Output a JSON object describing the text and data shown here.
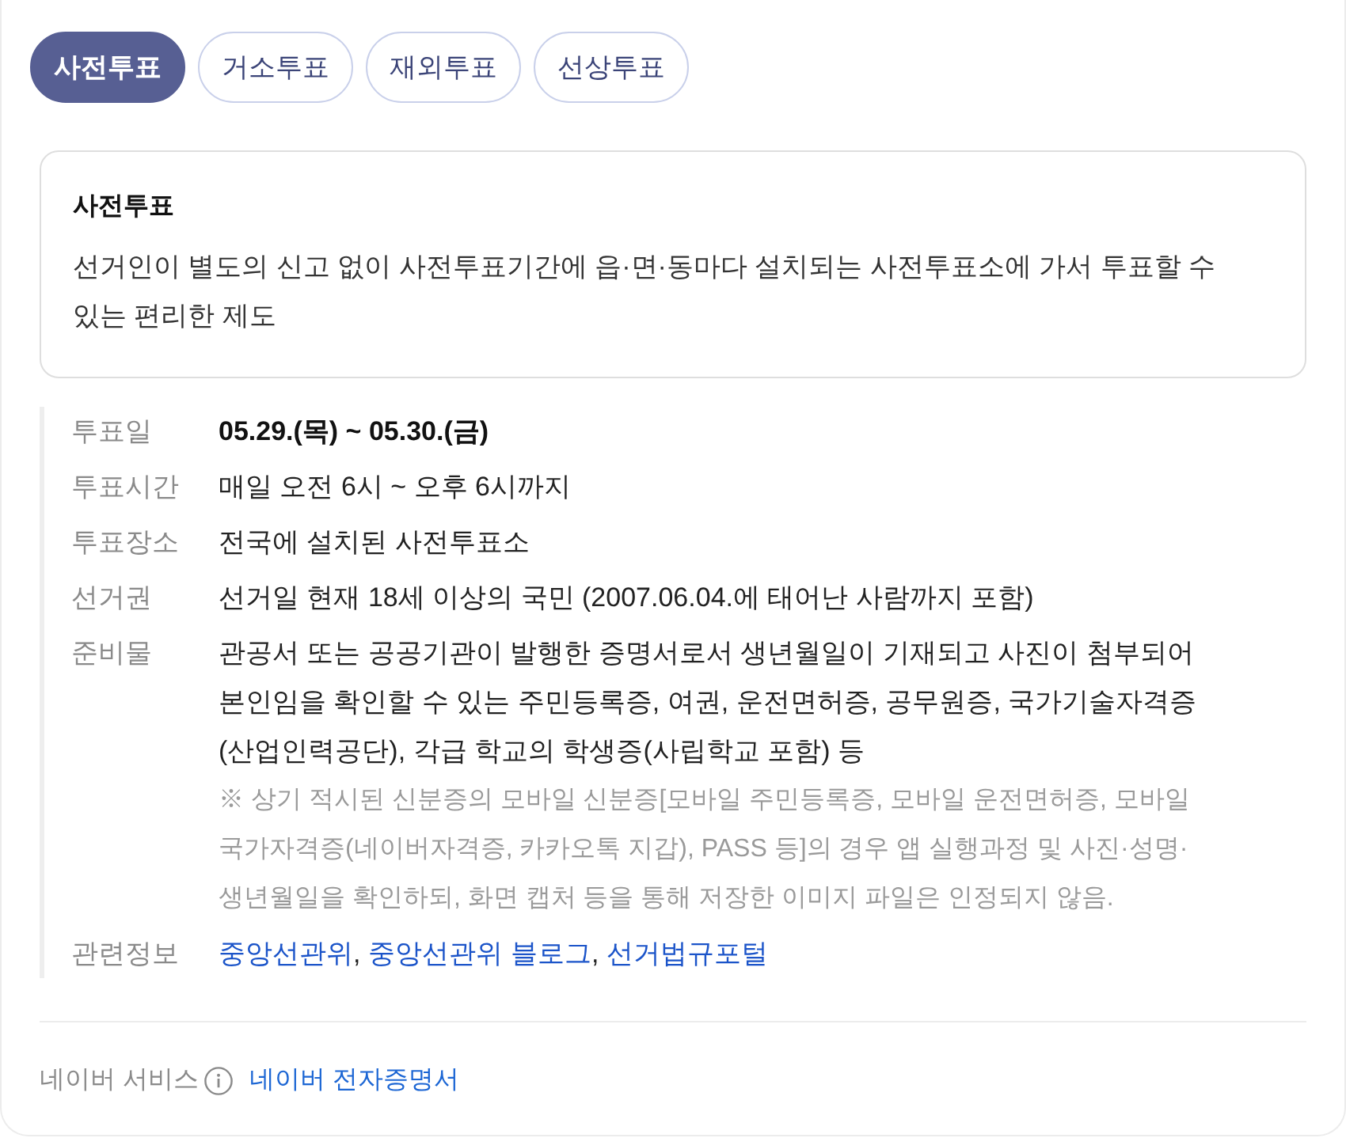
{
  "tabs": [
    {
      "label": "사전투표",
      "selected": true
    },
    {
      "label": "거소투표",
      "selected": false
    },
    {
      "label": "재외투표",
      "selected": false
    },
    {
      "label": "선상투표",
      "selected": false
    }
  ],
  "definition": {
    "title": "사전투표",
    "text": "선거인이 별도의 신고 없이 사전투표기간에 읍·면·동마다 설치되는 사전투표소에 가서 투표할 수 있는 편리한 제도"
  },
  "details": [
    {
      "kind": "text",
      "label": "투표일",
      "value": "05.29.(목) ~ 05.30.(금)",
      "bold": true
    },
    {
      "kind": "text",
      "label": "투표시간",
      "value": "매일 오전 6시 ~ 오후 6시까지",
      "bold": false
    },
    {
      "kind": "text",
      "label": "투표장소",
      "value": "전국에 설치된 사전투표소",
      "bold": false
    },
    {
      "kind": "text",
      "label": "선거권",
      "value": "선거일 현재 18세 이상의 국민 (2007.06.04.에 태어난 사람까지 포함)",
      "bold": false
    },
    {
      "kind": "text",
      "label": "준비물",
      "value": "관공서 또는 공공기관이 발행한 증명서로서 생년월일이 기재되고 사진이 첨부되어 본인임을 확인할 수 있는 주민등록증, 여권, 운전면허증, 공무원증, 국가기술자격증(산업인력공단), 각급 학교의 학생증(사립학교 포함) 등",
      "bold": false,
      "note": "※ 상기 적시된 신분증의 모바일 신분증[모바일 주민등록증, 모바일 운전면허증, 모바일 국가자격증(네이버자격증, 카카오톡 지갑), PASS 등]의 경우 앱 실행과정 및 사진·성명·생년월일을 확인하되, 화면 캡처 등을 통해 저장한 이미지 파일은 인정되지 않음."
    },
    {
      "kind": "links",
      "label": "관련정보",
      "links": [
        "중앙선관위",
        "중앙선관위 블로그",
        "선거법규포털"
      ],
      "separator": ","
    }
  ],
  "footer": {
    "label": "네이버 서비스",
    "link": "네이버 전자증명서"
  }
}
